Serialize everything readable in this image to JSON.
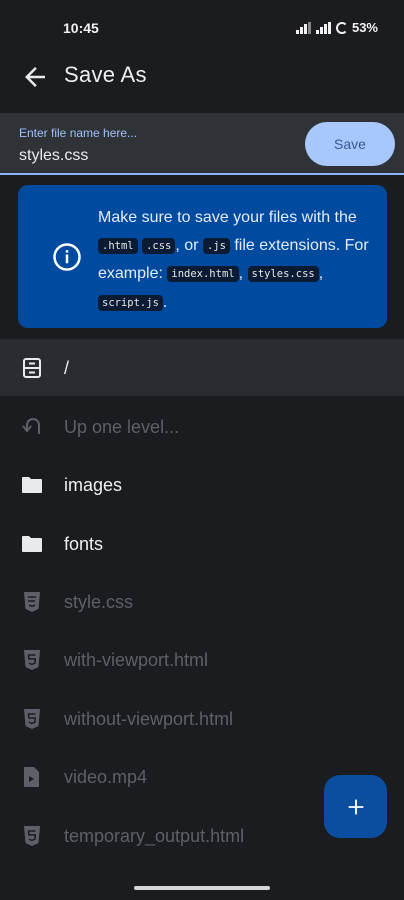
{
  "status_bar": {
    "time": "10:45",
    "battery": "53%"
  },
  "header": {
    "title": "Save As"
  },
  "filename": {
    "placeholder": "Enter file name here...",
    "value": "styles.css",
    "save_label": "Save"
  },
  "info": {
    "line1": "Make sure to save your files with the",
    "ext_html": ".html",
    "ext_css": ".css",
    "or": ", or",
    "ext_js": ".js",
    "line2": "file extensions. For example:",
    "ex1": "index.html",
    "ex2": "styles.css",
    "ex3": "script.js",
    "comma": ",",
    "period": "."
  },
  "path": {
    "current": "/",
    "icon": "storage-icon"
  },
  "list": [
    {
      "label": "Up one level...",
      "icon": "up-level-icon",
      "style": "dim"
    },
    {
      "label": "images",
      "icon": "folder-icon",
      "style": "bright"
    },
    {
      "label": "fonts",
      "icon": "folder-icon",
      "style": "bright"
    },
    {
      "label": "style.css",
      "icon": "css-file-icon",
      "style": "dim"
    },
    {
      "label": "with-viewport.html",
      "icon": "html-file-icon",
      "style": "dim"
    },
    {
      "label": "without-viewport.html",
      "icon": "html-file-icon",
      "style": "dim"
    },
    {
      "label": "video.mp4",
      "icon": "video-file-icon",
      "style": "dim"
    },
    {
      "label": "temporary_output.html",
      "icon": "html-file-icon",
      "style": "dim"
    }
  ],
  "fab": {
    "icon": "plus-icon"
  },
  "colors": {
    "accent": "#a8c7fa",
    "card": "#004a9f",
    "background": "#1b1c1f"
  }
}
